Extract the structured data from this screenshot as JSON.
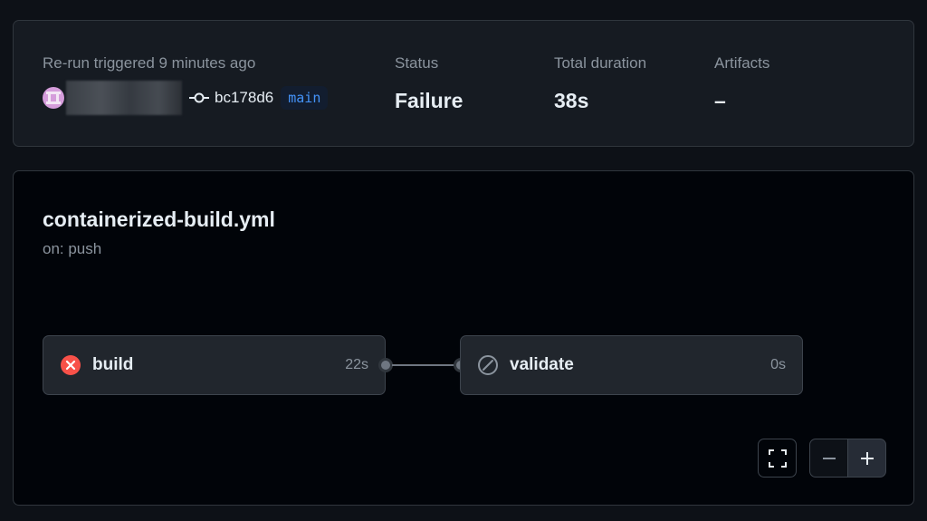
{
  "summary": {
    "trigger_label": "Re-run triggered 9 minutes ago",
    "commit_sha": "bc178d6",
    "branch": "main",
    "status_label": "Status",
    "status_value": "Failure",
    "duration_label": "Total duration",
    "duration_value": "38s",
    "artifacts_label": "Artifacts",
    "artifacts_value": "–"
  },
  "workflow": {
    "file_name": "containerized-build.yml",
    "trigger": "on: push",
    "jobs": [
      {
        "name": "build",
        "duration": "22s",
        "status": "failure",
        "icon": "x-circle-icon",
        "color": "#f85149"
      },
      {
        "name": "validate",
        "duration": "0s",
        "status": "skipped",
        "icon": "skip-icon",
        "color": "#8b949e"
      }
    ]
  },
  "controls": {
    "fullscreen_icon": "fullscreen-icon",
    "zoom_out_icon": "minus-icon",
    "zoom_in_icon": "plus-icon"
  }
}
